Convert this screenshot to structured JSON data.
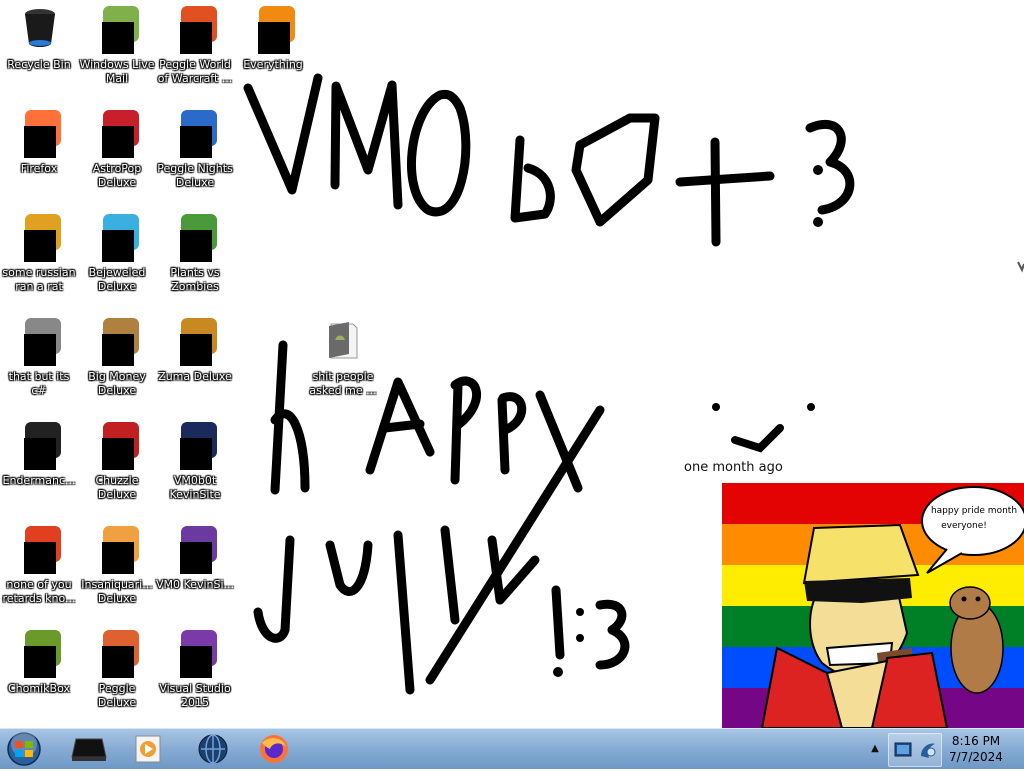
{
  "desktop": {
    "icons": [
      {
        "name": "recycle-bin-icon",
        "label": "Recycle Bin",
        "censored": false
      },
      {
        "name": "windows-live-mail-icon",
        "label": "Windows Live Mail",
        "censored": true
      },
      {
        "name": "peggle-world-of-warcraft-icon",
        "label": "Peggle World of Warcraft ...",
        "censored": true
      },
      {
        "name": "everything-icon",
        "label": "Everything",
        "censored": true
      },
      {
        "name": "firefox-icon",
        "label": "Firefox",
        "censored": true
      },
      {
        "name": "astropop-deluxe-icon",
        "label": "AstroPop Deluxe",
        "censored": true
      },
      {
        "name": "peggle-nights-deluxe-icon",
        "label": "Peggle Nights Deluxe",
        "censored": true
      },
      {
        "name": "some-russian-ran-a-rat-icon",
        "label": "some russian ran a rat",
        "censored": true
      },
      {
        "name": "bejeweled-deluxe-icon",
        "label": "Bejeweled Deluxe",
        "censored": true
      },
      {
        "name": "plants-vs-zombies-icon",
        "label": "Plants vs Zombies",
        "censored": true
      },
      {
        "name": "that-but-its-csharp-icon",
        "label": "that but its c#",
        "censored": true
      },
      {
        "name": "big-money-deluxe-icon",
        "label": "Big Money Deluxe",
        "censored": true
      },
      {
        "name": "zuma-deluxe-icon",
        "label": "Zuma Deluxe",
        "censored": true
      },
      {
        "name": "shit-people-asked-me-folder-icon",
        "label": "shit people asked me ...",
        "censored": false
      },
      {
        "name": "enderman-icon",
        "label": "Endermanc...",
        "censored": true
      },
      {
        "name": "chuzzle-deluxe-icon",
        "label": "Chuzzle Deluxe",
        "censored": true
      },
      {
        "name": "vm0b0t-kevinsite-icon",
        "label": "VM0b0t KevinSite",
        "censored": true
      },
      {
        "name": "none-of-you-retards-icon",
        "label": "none of you retards kno...",
        "censored": true
      },
      {
        "name": "insaniquarium-deluxe-icon",
        "label": "Insaniquari... Deluxe",
        "censored": true
      },
      {
        "name": "vm0-kevinsite-icon",
        "label": "VM0 KevinSi...",
        "censored": true
      },
      {
        "name": "chomikbox-icon",
        "label": "ChomikBox",
        "censored": true
      },
      {
        "name": "peggle-deluxe-icon",
        "label": "Peggle Deluxe",
        "censored": true
      },
      {
        "name": "visual-studio-2015-icon",
        "label": "Visual Studio 2015",
        "censored": true
      }
    ],
    "gadget_label": "one month ago",
    "pride_image": {
      "speech_line1": "happy pride month",
      "speech_line2": "everyone!"
    }
  },
  "taskbar": {
    "start_icon": "windows-start-orb-icon",
    "pinned": [
      {
        "name": "taskbar-black-app-icon"
      },
      {
        "name": "taskbar-media-player-icon"
      },
      {
        "name": "taskbar-globe-app-icon"
      },
      {
        "name": "taskbar-firefox-icon"
      }
    ],
    "tray": {
      "show_hidden": "▲",
      "clock_time": "8:16 PM",
      "clock_date": "7/7/2024"
    }
  }
}
